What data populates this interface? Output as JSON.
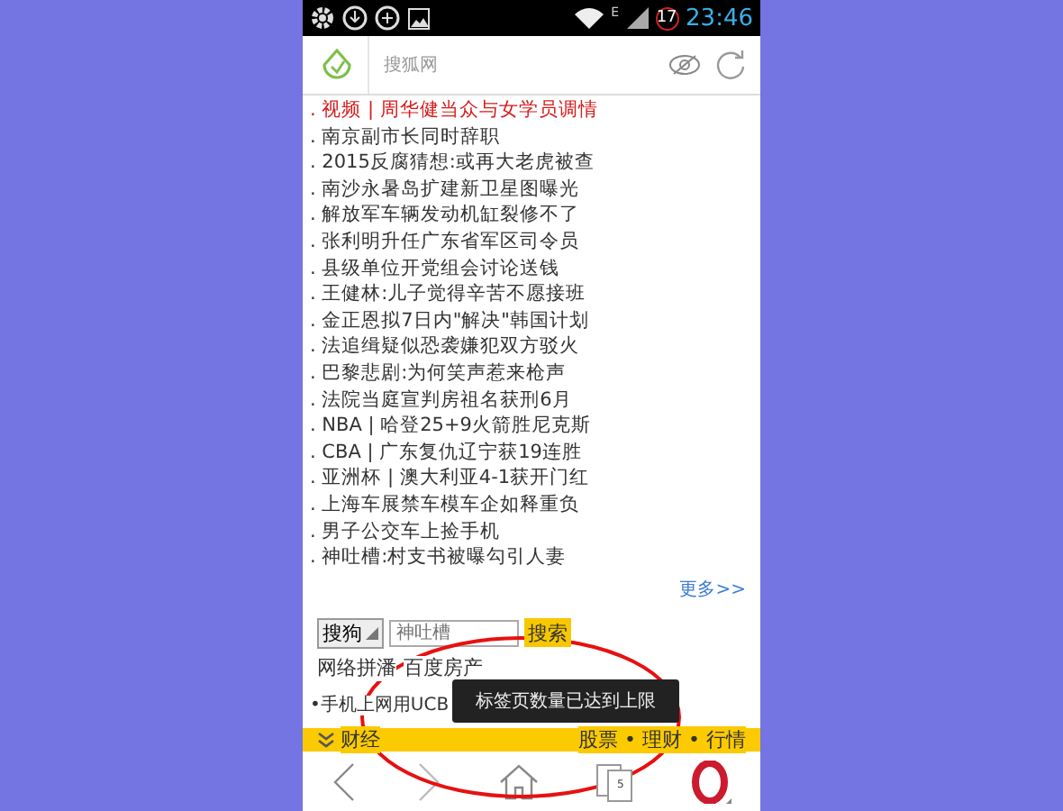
{
  "status_bar": {
    "network": "E",
    "battery": "17",
    "time": "23:46"
  },
  "address_bar": {
    "title": "搜狐网"
  },
  "news": [
    {
      "text": ". 视频 | 周华健当众与女学员调情",
      "kind": "highlight"
    },
    {
      "text": ". 南京副市长同时辞职",
      "kind": "normal"
    },
    {
      "text": ". 2015反腐猜想:或再大老虎被查",
      "kind": "normal"
    },
    {
      "text": ". 南沙永暑岛扩建新卫星图曝光",
      "kind": "normal"
    },
    {
      "text": ". 解放军车辆发动机缸裂修不了",
      "kind": "normal"
    },
    {
      "text": ". 张利明升任广东省军区司令员",
      "kind": "normal"
    },
    {
      "text": ". 县级单位开党组会讨论送钱",
      "kind": "normal"
    },
    {
      "text": ". 王健林:儿子觉得辛苦不愿接班",
      "kind": "normal"
    },
    {
      "text": ". 金正恩拟7日内\"解决\"韩国计划",
      "kind": "normal"
    },
    {
      "text": ". 法追缉疑似恐袭嫌犯双方驳火",
      "kind": "normal"
    },
    {
      "text": ". 巴黎悲剧:为何笑声惹来枪声",
      "kind": "normal"
    },
    {
      "text": ". 法院当庭宣判房祖名获刑6月",
      "kind": "normal"
    },
    {
      "text": ". NBA | 哈登25+9火箭胜尼克斯",
      "kind": "normal"
    },
    {
      "text": ". CBA | 广东复仇辽宁获19连胜",
      "kind": "normal"
    },
    {
      "text": ". 亚洲杯 | 澳大利亚4-1获开门红",
      "kind": "normal"
    },
    {
      "text": ". 上海车展禁车模车企如释重负",
      "kind": "normal"
    },
    {
      "text": ". 男子公交车上捡手机",
      "kind": "normal"
    },
    {
      "text": ". 神吐槽:村支书被曝勾引人妻",
      "kind": "normal"
    }
  ],
  "more_link": "更多>>",
  "search": {
    "engine": "搜狗",
    "placeholder": "神吐槽",
    "button": "搜索"
  },
  "links": [
    "网络拼潘",
    "百度房产"
  ],
  "promo": "•手机上网用UCB",
  "toast": "标签页数量已达到上限",
  "category_bar": {
    "title": "财经",
    "links": "股票 • 理财 • 行情"
  },
  "toolbar": {
    "tab_count": "5"
  }
}
